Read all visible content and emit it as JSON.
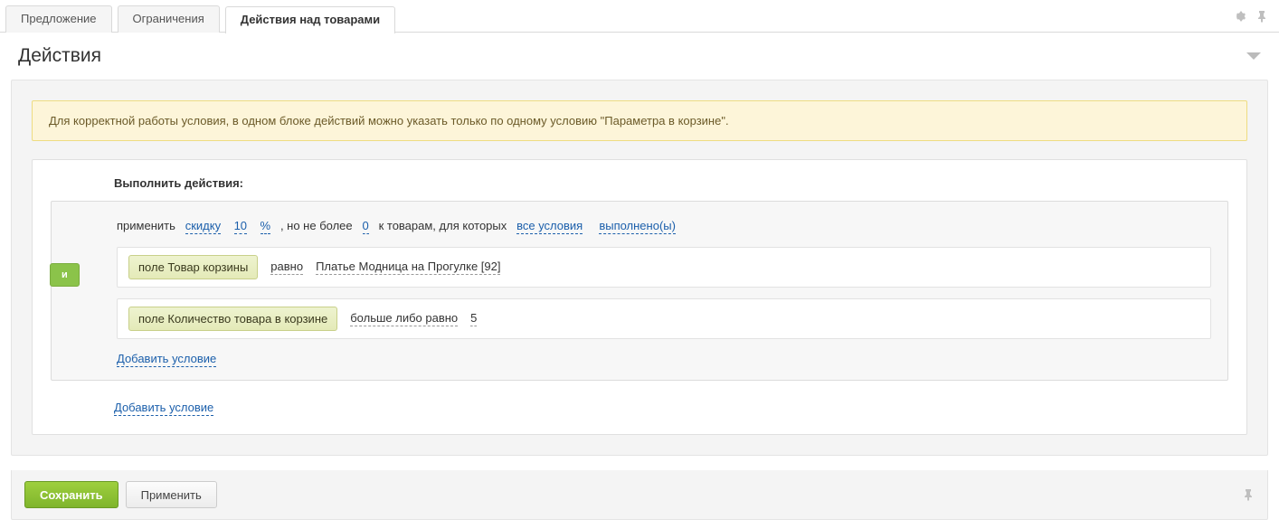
{
  "tabs": {
    "offer": "Предложение",
    "restrictions": "Ограничения",
    "actions": "Действия над товарами"
  },
  "section": {
    "title": "Действия"
  },
  "notice": "Для корректной работы условия, в одном блоке действий можно указать только по одному условию \"Параметра в корзине\".",
  "rules": {
    "heading": "Выполнить действия:",
    "line": {
      "t_apply": "применить  ",
      "discount_label": "скидку",
      "discount_value": "10",
      "unit": "%",
      "t_limit": "  , но не более  ",
      "limit_value": "0",
      "t_for": "  к товарам, для которых  ",
      "mode_label": "все условия",
      "done_label": "выполнено(ы)"
    },
    "connector": "И",
    "cond1": {
      "field": "поле Товар корзины",
      "op": "равно",
      "value": "Платье Модница на Прогулке [92]"
    },
    "cond2": {
      "field": "поле Количество товара в корзине",
      "op": "больше либо равно",
      "value": "5"
    },
    "add_inner": "Добавить условие",
    "add_outer": "Добавить условие"
  },
  "buttons": {
    "save": "Сохранить",
    "apply": "Применить"
  }
}
